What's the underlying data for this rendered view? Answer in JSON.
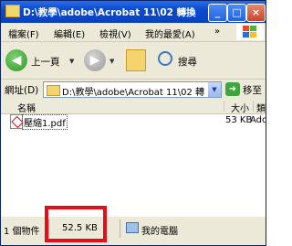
{
  "window": {
    "title": "D:\\教學\\adobe\\Acrobat 11\\02 轉換...",
    "icon": "folder-icon",
    "controls": [
      "minimize",
      "maximize",
      "close"
    ]
  },
  "menu": {
    "items": [
      "檔案(F)",
      "編輯(E)",
      "檢視(V)",
      "我的最愛(A)"
    ],
    "overflow": "»"
  },
  "toolbar": {
    "back_label": "上一頁",
    "search_label": "搜尋"
  },
  "address": {
    "label": "網址(D)",
    "path": "D:\\教學\\adobe\\Acrobat 11\\02 轉",
    "go_label": "移至"
  },
  "columns": {
    "name": "名稱",
    "size": "大小",
    "type": "類型"
  },
  "files": [
    {
      "name": "壓縮1.pdf",
      "size": "53 KB",
      "type": "Adob"
    }
  ],
  "status": {
    "count": "1 個物件",
    "size": "52.5 KB",
    "location": "我的電腦"
  },
  "colors": {
    "titlebar": "#0a4ad0",
    "highlight": "#e0101a"
  }
}
